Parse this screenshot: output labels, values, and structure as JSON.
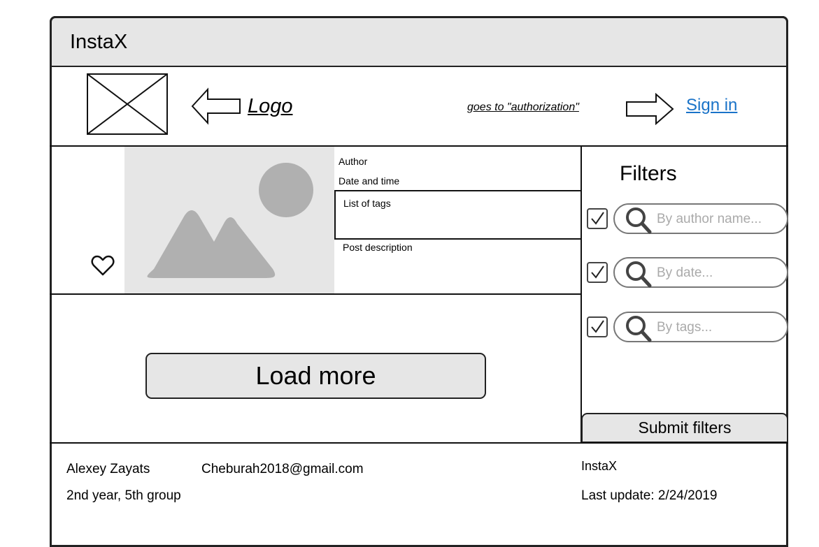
{
  "header": {
    "title": "InstaX"
  },
  "nav": {
    "logo_label": "Logo",
    "note": "goes to \"authorization\"",
    "signin_label": "Sign in"
  },
  "post": {
    "author": "Author",
    "date_time": "Date and time",
    "tags": "List of tags",
    "description": "Post description"
  },
  "load_more_label": "Load more",
  "filters": {
    "title": "Filters",
    "items": [
      {
        "placeholder": "By author name...",
        "checked": true
      },
      {
        "placeholder": "By date...",
        "checked": true
      },
      {
        "placeholder": "By tags...",
        "checked": true
      }
    ],
    "submit_label": "Submit filters"
  },
  "footer": {
    "name": "Alexey Zayats",
    "email": "Cheburah2018@gmail.com",
    "group": "2nd year, 5th group",
    "app_name": "InstaX",
    "last_update": "Last update: 2/24/2019"
  },
  "colors": {
    "titlebar_bg": "#e6e6e6",
    "link": "#1a73c8",
    "placeholder_image": "#e6e6e6",
    "placeholder_shape": "#b0b0b0"
  }
}
